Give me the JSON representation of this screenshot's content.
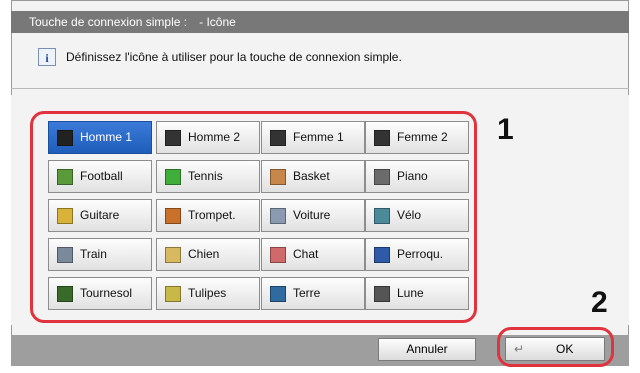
{
  "dialog": {
    "title": "Touche de connexion simple :",
    "subtitle": "- Icône",
    "message": "Définissez l'icône à utiliser pour la touche de connexion simple."
  },
  "icons": [
    {
      "label": "Homme 1",
      "icon": "male-silhouette-icon",
      "color": "#222222",
      "selected": true
    },
    {
      "label": "Homme 2",
      "icon": "male-silhouette-icon",
      "color": "#333333",
      "selected": false
    },
    {
      "label": "Femme 1",
      "icon": "female-silhouette-icon",
      "color": "#333333",
      "selected": false
    },
    {
      "label": "Femme 2",
      "icon": "female-silhouette-icon",
      "color": "#333333",
      "selected": false
    },
    {
      "label": "Football",
      "icon": "football-icon",
      "color": "#5a9a3a",
      "selected": false
    },
    {
      "label": "Tennis",
      "icon": "tennis-icon",
      "color": "#3fae3a",
      "selected": false
    },
    {
      "label": "Basket",
      "icon": "basketball-icon",
      "color": "#c8874a",
      "selected": false
    },
    {
      "label": "Piano",
      "icon": "piano-icon",
      "color": "#6b6b6b",
      "selected": false
    },
    {
      "label": "Guitare",
      "icon": "guitar-icon",
      "color": "#d9b23a",
      "selected": false
    },
    {
      "label": "Trompet.",
      "icon": "trumpet-icon",
      "color": "#c9702a",
      "selected": false
    },
    {
      "label": "Voiture",
      "icon": "car-icon",
      "color": "#8a9ab0",
      "selected": false
    },
    {
      "label": "Vélo",
      "icon": "bicycle-icon",
      "color": "#4a8a9a",
      "selected": false
    },
    {
      "label": "Train",
      "icon": "train-icon",
      "color": "#7a8a9a",
      "selected": false
    },
    {
      "label": "Chien",
      "icon": "dog-icon",
      "color": "#d8b860",
      "selected": false
    },
    {
      "label": "Chat",
      "icon": "cat-icon",
      "color": "#d06a6a",
      "selected": false
    },
    {
      "label": "Perroqu.",
      "icon": "parrot-icon",
      "color": "#2f5aa8",
      "selected": false
    },
    {
      "label": "Tournesol",
      "icon": "sunflower-icon",
      "color": "#3a6a2a",
      "selected": false
    },
    {
      "label": "Tulipes",
      "icon": "tulips-icon",
      "color": "#c8b848",
      "selected": false
    },
    {
      "label": "Terre",
      "icon": "earth-icon",
      "color": "#2f6aa0",
      "selected": false
    },
    {
      "label": "Lune",
      "icon": "moon-icon",
      "color": "#555555",
      "selected": false
    }
  ],
  "callouts": [
    "1",
    "2"
  ],
  "footer": {
    "cancel_label": "Annuler",
    "ok_label": "OK",
    "ok_glyph": "↵"
  }
}
